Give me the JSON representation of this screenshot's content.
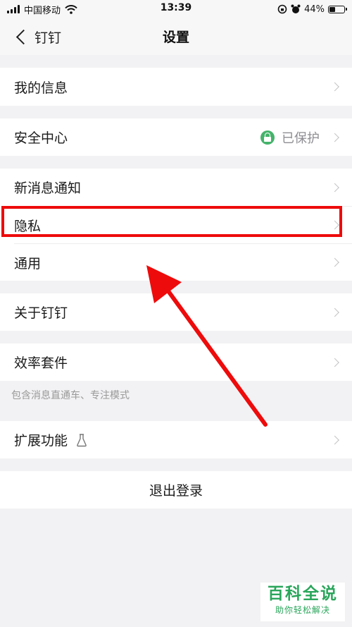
{
  "status_bar": {
    "carrier": "中国移动",
    "time": "13:39",
    "battery": "44%",
    "battery_level": 0.44,
    "icons": [
      "signal-icon",
      "wifi-icon",
      "rotation-lock-icon",
      "alarm-icon",
      "battery-icon"
    ]
  },
  "nav": {
    "back_label": "钉钉",
    "title": "设置"
  },
  "rows": {
    "my_info": "我的信息",
    "security_center": "安全中心",
    "security_status": "已保护",
    "notifications": "新消息通知",
    "privacy": "隐私",
    "general": "通用",
    "about": "关于钉钉",
    "efficiency_suite": "效率套件",
    "efficiency_caption": "包含消息直通车、专注模式",
    "extensions": "扩展功能",
    "logout": "退出登录"
  },
  "watermark": {
    "title": "百科全说",
    "subtitle": "助你轻松解决"
  },
  "colors": {
    "accent_green": "#45b36b",
    "highlight_red": "#ee0b0b",
    "watermark_green": "#2aa65b",
    "background": "#f2f2f4"
  }
}
